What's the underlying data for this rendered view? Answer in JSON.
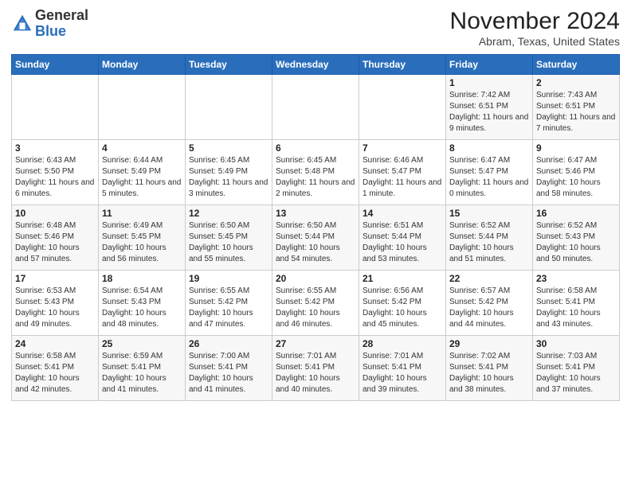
{
  "header": {
    "logo_general": "General",
    "logo_blue": "Blue",
    "month_title": "November 2024",
    "location": "Abram, Texas, United States"
  },
  "weekdays": [
    "Sunday",
    "Monday",
    "Tuesday",
    "Wednesday",
    "Thursday",
    "Friday",
    "Saturday"
  ],
  "weeks": [
    [
      {
        "day": "",
        "info": ""
      },
      {
        "day": "",
        "info": ""
      },
      {
        "day": "",
        "info": ""
      },
      {
        "day": "",
        "info": ""
      },
      {
        "day": "",
        "info": ""
      },
      {
        "day": "1",
        "info": "Sunrise: 7:42 AM\nSunset: 6:51 PM\nDaylight: 11 hours and 9 minutes."
      },
      {
        "day": "2",
        "info": "Sunrise: 7:43 AM\nSunset: 6:51 PM\nDaylight: 11 hours and 7 minutes."
      }
    ],
    [
      {
        "day": "3",
        "info": "Sunrise: 6:43 AM\nSunset: 5:50 PM\nDaylight: 11 hours and 6 minutes."
      },
      {
        "day": "4",
        "info": "Sunrise: 6:44 AM\nSunset: 5:49 PM\nDaylight: 11 hours and 5 minutes."
      },
      {
        "day": "5",
        "info": "Sunrise: 6:45 AM\nSunset: 5:49 PM\nDaylight: 11 hours and 3 minutes."
      },
      {
        "day": "6",
        "info": "Sunrise: 6:45 AM\nSunset: 5:48 PM\nDaylight: 11 hours and 2 minutes."
      },
      {
        "day": "7",
        "info": "Sunrise: 6:46 AM\nSunset: 5:47 PM\nDaylight: 11 hours and 1 minute."
      },
      {
        "day": "8",
        "info": "Sunrise: 6:47 AM\nSunset: 5:47 PM\nDaylight: 11 hours and 0 minutes."
      },
      {
        "day": "9",
        "info": "Sunrise: 6:47 AM\nSunset: 5:46 PM\nDaylight: 10 hours and 58 minutes."
      }
    ],
    [
      {
        "day": "10",
        "info": "Sunrise: 6:48 AM\nSunset: 5:46 PM\nDaylight: 10 hours and 57 minutes."
      },
      {
        "day": "11",
        "info": "Sunrise: 6:49 AM\nSunset: 5:45 PM\nDaylight: 10 hours and 56 minutes."
      },
      {
        "day": "12",
        "info": "Sunrise: 6:50 AM\nSunset: 5:45 PM\nDaylight: 10 hours and 55 minutes."
      },
      {
        "day": "13",
        "info": "Sunrise: 6:50 AM\nSunset: 5:44 PM\nDaylight: 10 hours and 54 minutes."
      },
      {
        "day": "14",
        "info": "Sunrise: 6:51 AM\nSunset: 5:44 PM\nDaylight: 10 hours and 53 minutes."
      },
      {
        "day": "15",
        "info": "Sunrise: 6:52 AM\nSunset: 5:44 PM\nDaylight: 10 hours and 51 minutes."
      },
      {
        "day": "16",
        "info": "Sunrise: 6:52 AM\nSunset: 5:43 PM\nDaylight: 10 hours and 50 minutes."
      }
    ],
    [
      {
        "day": "17",
        "info": "Sunrise: 6:53 AM\nSunset: 5:43 PM\nDaylight: 10 hours and 49 minutes."
      },
      {
        "day": "18",
        "info": "Sunrise: 6:54 AM\nSunset: 5:43 PM\nDaylight: 10 hours and 48 minutes."
      },
      {
        "day": "19",
        "info": "Sunrise: 6:55 AM\nSunset: 5:42 PM\nDaylight: 10 hours and 47 minutes."
      },
      {
        "day": "20",
        "info": "Sunrise: 6:55 AM\nSunset: 5:42 PM\nDaylight: 10 hours and 46 minutes."
      },
      {
        "day": "21",
        "info": "Sunrise: 6:56 AM\nSunset: 5:42 PM\nDaylight: 10 hours and 45 minutes."
      },
      {
        "day": "22",
        "info": "Sunrise: 6:57 AM\nSunset: 5:42 PM\nDaylight: 10 hours and 44 minutes."
      },
      {
        "day": "23",
        "info": "Sunrise: 6:58 AM\nSunset: 5:41 PM\nDaylight: 10 hours and 43 minutes."
      }
    ],
    [
      {
        "day": "24",
        "info": "Sunrise: 6:58 AM\nSunset: 5:41 PM\nDaylight: 10 hours and 42 minutes."
      },
      {
        "day": "25",
        "info": "Sunrise: 6:59 AM\nSunset: 5:41 PM\nDaylight: 10 hours and 41 minutes."
      },
      {
        "day": "26",
        "info": "Sunrise: 7:00 AM\nSunset: 5:41 PM\nDaylight: 10 hours and 41 minutes."
      },
      {
        "day": "27",
        "info": "Sunrise: 7:01 AM\nSunset: 5:41 PM\nDaylight: 10 hours and 40 minutes."
      },
      {
        "day": "28",
        "info": "Sunrise: 7:01 AM\nSunset: 5:41 PM\nDaylight: 10 hours and 39 minutes."
      },
      {
        "day": "29",
        "info": "Sunrise: 7:02 AM\nSunset: 5:41 PM\nDaylight: 10 hours and 38 minutes."
      },
      {
        "day": "30",
        "info": "Sunrise: 7:03 AM\nSunset: 5:41 PM\nDaylight: 10 hours and 37 minutes."
      }
    ]
  ]
}
